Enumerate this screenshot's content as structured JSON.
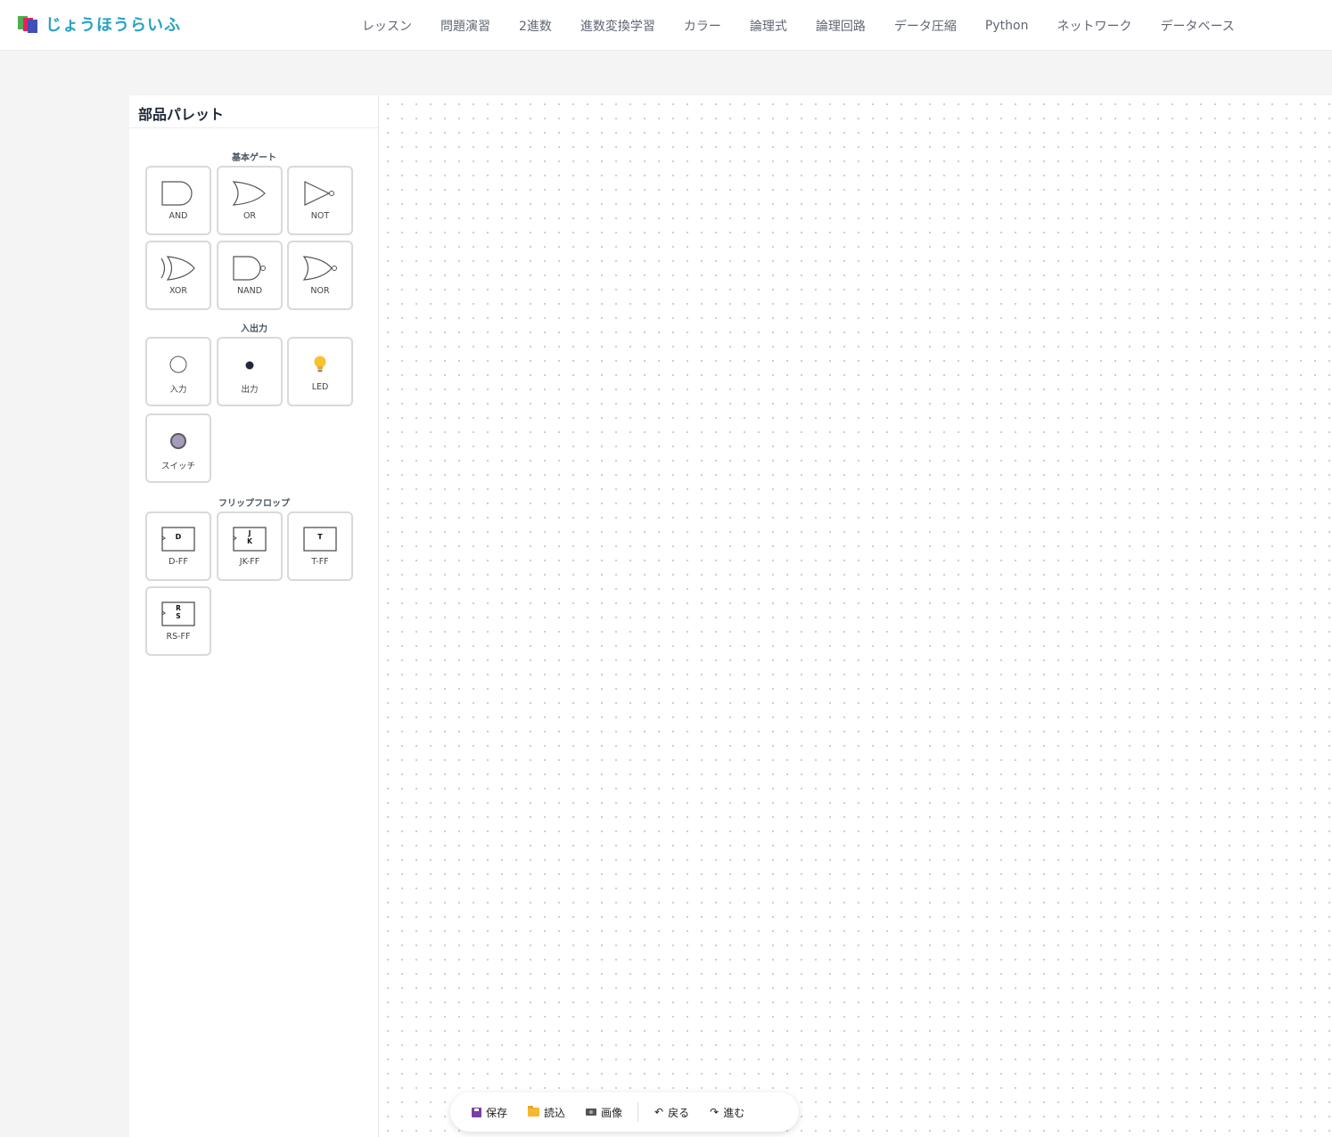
{
  "header": {
    "logo_text": "じょうほうらいふ",
    "nav": [
      "レッスン",
      "問題演習",
      "2進数",
      "進数変換学習",
      "カラー",
      "論理式",
      "論理回路",
      "データ圧縮",
      "Python",
      "ネットワーク",
      "データベース"
    ]
  },
  "palette": {
    "title": "部品パレット",
    "sections": {
      "basic": "基本ゲート",
      "io": "入出力",
      "ff": "フリップフロップ"
    },
    "parts": {
      "and": "AND",
      "or": "OR",
      "not": "NOT",
      "xor": "XOR",
      "nand": "NAND",
      "nor": "NOR",
      "input": "入力",
      "output": "出力",
      "led": "LED",
      "switch": "スイッチ",
      "dff": "D-FF",
      "jkff": "JK-FF",
      "tff": "T-FF",
      "rsff": "RS-FF"
    },
    "ff_symbols": {
      "d": "D",
      "j": "J",
      "k": "K",
      "t": "T",
      "r": "R",
      "s": "S"
    }
  },
  "toolbar": {
    "save": "保存",
    "load": "読込",
    "image": "画像",
    "undo": "戻る",
    "redo": "進む",
    "undo_arrow": "↶",
    "redo_arrow": "↷"
  },
  "colors": {
    "brand": "#26a3c4",
    "nav_text": "#5f6672"
  }
}
